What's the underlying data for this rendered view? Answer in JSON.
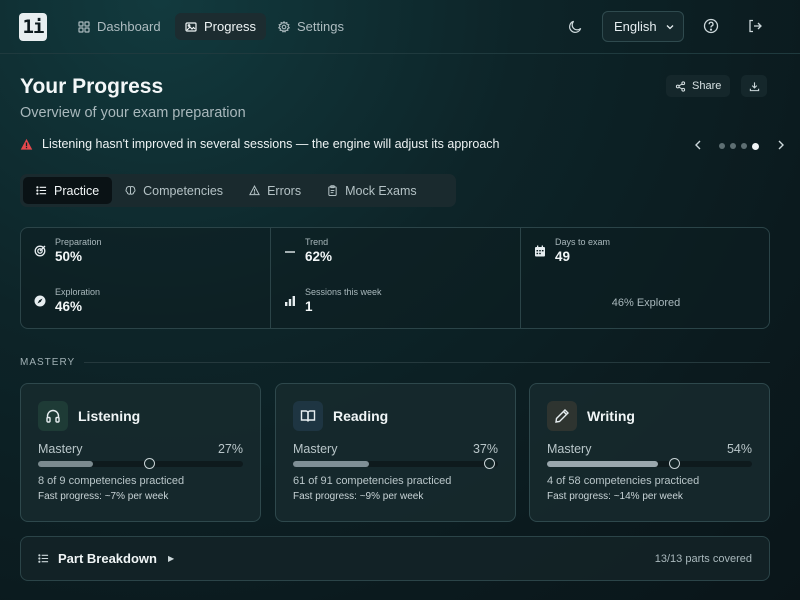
{
  "logo": {
    "text": "1i"
  },
  "nav": {
    "items": [
      {
        "label": "Dashboard",
        "icon": "grid-icon",
        "active": false
      },
      {
        "label": "Progress",
        "icon": "image-icon",
        "active": true
      },
      {
        "label": "Settings",
        "icon": "gear-icon",
        "active": false
      }
    ],
    "language": "English"
  },
  "header": {
    "title": "Your Progress",
    "subtitle": "Overview of your exam preparation",
    "share_label": "Share"
  },
  "alert": {
    "text": "Listening hasn't improved in several sessions — the engine will adjust its approach",
    "color": "#e5484d",
    "carousel_total": 4,
    "carousel_active": 4
  },
  "tabs": [
    {
      "label": "Practice",
      "active": true
    },
    {
      "label": "Competencies",
      "active": false
    },
    {
      "label": "Errors",
      "active": false
    },
    {
      "label": "Mock Exams",
      "active": false
    }
  ],
  "stats": {
    "preparation": {
      "label": "Preparation",
      "value": "50%"
    },
    "exploration": {
      "label": "Exploration",
      "value": "46%"
    },
    "trend": {
      "label": "Trend",
      "value": "62%"
    },
    "sessions": {
      "label": "Sessions this week",
      "value": "1"
    },
    "days": {
      "label": "Days to exam",
      "value": "49"
    },
    "explored_text": "46% Explored"
  },
  "mastery": {
    "section_label": "MASTERY",
    "cards": [
      {
        "name": "Listening",
        "mastery_label": "Mastery",
        "pct": "27%",
        "fill": 0.27,
        "knob": 0.54,
        "competencies": "8 of 9 competencies practiced",
        "fast": "Fast progress: ~7% per week",
        "icon": "headphones-icon",
        "icon_bg": "#1e3b36",
        "fill_color": "#7b8a8f"
      },
      {
        "name": "Reading",
        "mastery_label": "Mastery",
        "pct": "37%",
        "fill": 0.37,
        "knob": 0.955,
        "competencies": "61 of 91 competencies practiced",
        "fast": "Fast progress: ~9% per week",
        "icon": "book-icon",
        "icon_bg": "#1e3542",
        "fill_color": "#7f8f96"
      },
      {
        "name": "Writing",
        "mastery_label": "Mastery",
        "pct": "54%",
        "fill": 0.54,
        "knob": 0.62,
        "competencies": "4 of 58 competencies practiced",
        "fast": "Fast progress: ~14% per week",
        "icon": "pencil-icon",
        "icon_bg": "#2e3430",
        "fill_color": "#9aa7ad"
      }
    ]
  },
  "breakdown": {
    "label": "Part Breakdown",
    "coverage": "13/13 parts covered"
  }
}
